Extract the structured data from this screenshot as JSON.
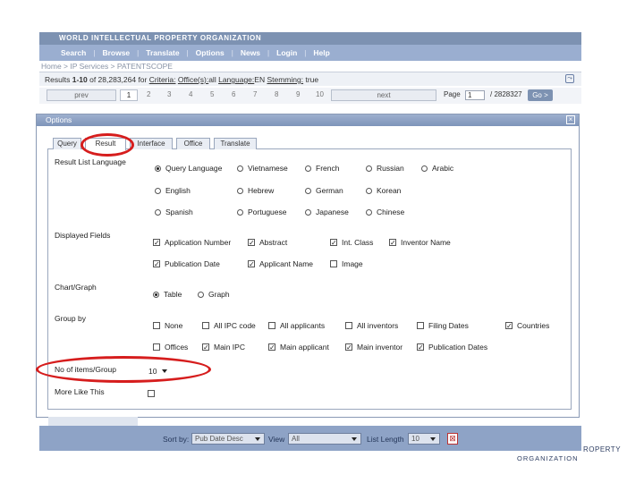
{
  "org_banner": "WORLD INTELLECTUAL PROPERTY ORGANIZATION",
  "nav": [
    "Search",
    "Browse",
    "Translate",
    "Options",
    "News",
    "Login",
    "Help"
  ],
  "breadcrumb": "Home > IP Services > PATENTSCOPE",
  "results": {
    "prefix": "Results ",
    "range": "1-10",
    "of_text": " of 28,283,264 for ",
    "criteria_label": "Criteria:",
    "offices_label": "Office(s):",
    "offices_value": "all",
    "language_label": "Language:",
    "language_value": "EN",
    "stemming_label": "Stemming:",
    "stemming_value": "true"
  },
  "pager": {
    "prev": "prev",
    "pages": [
      "1",
      "2",
      "3",
      "4",
      "5",
      "6",
      "7",
      "8",
      "9",
      "10"
    ],
    "next": "next",
    "page_label": "Page",
    "page_value": "1",
    "total": "/ 2828327",
    "go": "Go >"
  },
  "dialog": {
    "title": "Options",
    "close": "×",
    "tabs": [
      "Query",
      "Result",
      "Interface",
      "Office",
      "Translate"
    ],
    "active_tab": "Result",
    "result_list_language": {
      "label": "Result List Language",
      "options": [
        "Query Language",
        "Vietnamese",
        "French",
        "Russian",
        "Arabic",
        "English",
        "Hebrew",
        "German",
        "Korean",
        "Spanish",
        "Portuguese",
        "Japanese",
        "Chinese"
      ],
      "selected": "Query Language"
    },
    "displayed_fields": {
      "label": "Displayed Fields",
      "options": [
        {
          "label": "Application Number",
          "checked": true
        },
        {
          "label": "Abstract",
          "checked": true
        },
        {
          "label": "Int. Class",
          "checked": true
        },
        {
          "label": "Inventor Name",
          "checked": true
        },
        {
          "label": "Publication Date",
          "checked": true
        },
        {
          "label": "Applicant Name",
          "checked": true
        },
        {
          "label": "Image",
          "checked": false
        }
      ]
    },
    "chart_graph": {
      "label": "Chart/Graph",
      "options": [
        "Table",
        "Graph"
      ],
      "selected": "Table"
    },
    "group_by": {
      "label": "Group by",
      "options": [
        {
          "label": "None",
          "checked": false
        },
        {
          "label": "All IPC code",
          "checked": false
        },
        {
          "label": "All applicants",
          "checked": false
        },
        {
          "label": "All inventors",
          "checked": false
        },
        {
          "label": "Filing Dates",
          "checked": false
        },
        {
          "label": "Countries",
          "checked": true
        },
        {
          "label": "Offices",
          "checked": false
        },
        {
          "label": "Main IPC",
          "checked": true
        },
        {
          "label": "Main applicant",
          "checked": true
        },
        {
          "label": "Main inventor",
          "checked": true
        },
        {
          "label": "Publication Dates",
          "checked": true
        }
      ]
    },
    "items_per_group": {
      "label": "No of items/Group",
      "value": "10"
    },
    "more_like_this": {
      "label": "More Like This",
      "checked": false
    }
  },
  "bottom_bar": {
    "sort_label": "Sort by:",
    "sort_value": "Pub Date Desc",
    "view_label": "View",
    "view_value": "All",
    "list_length_label": "List Length",
    "list_length_value": "10"
  },
  "logo": {
    "line1": "ROPERTY",
    "line2": "ORGANIZATION"
  },
  "colors": {
    "annotation": "#d61d1d",
    "nav_bar": "#9aaed0",
    "header_bar": "#7d92b2"
  }
}
